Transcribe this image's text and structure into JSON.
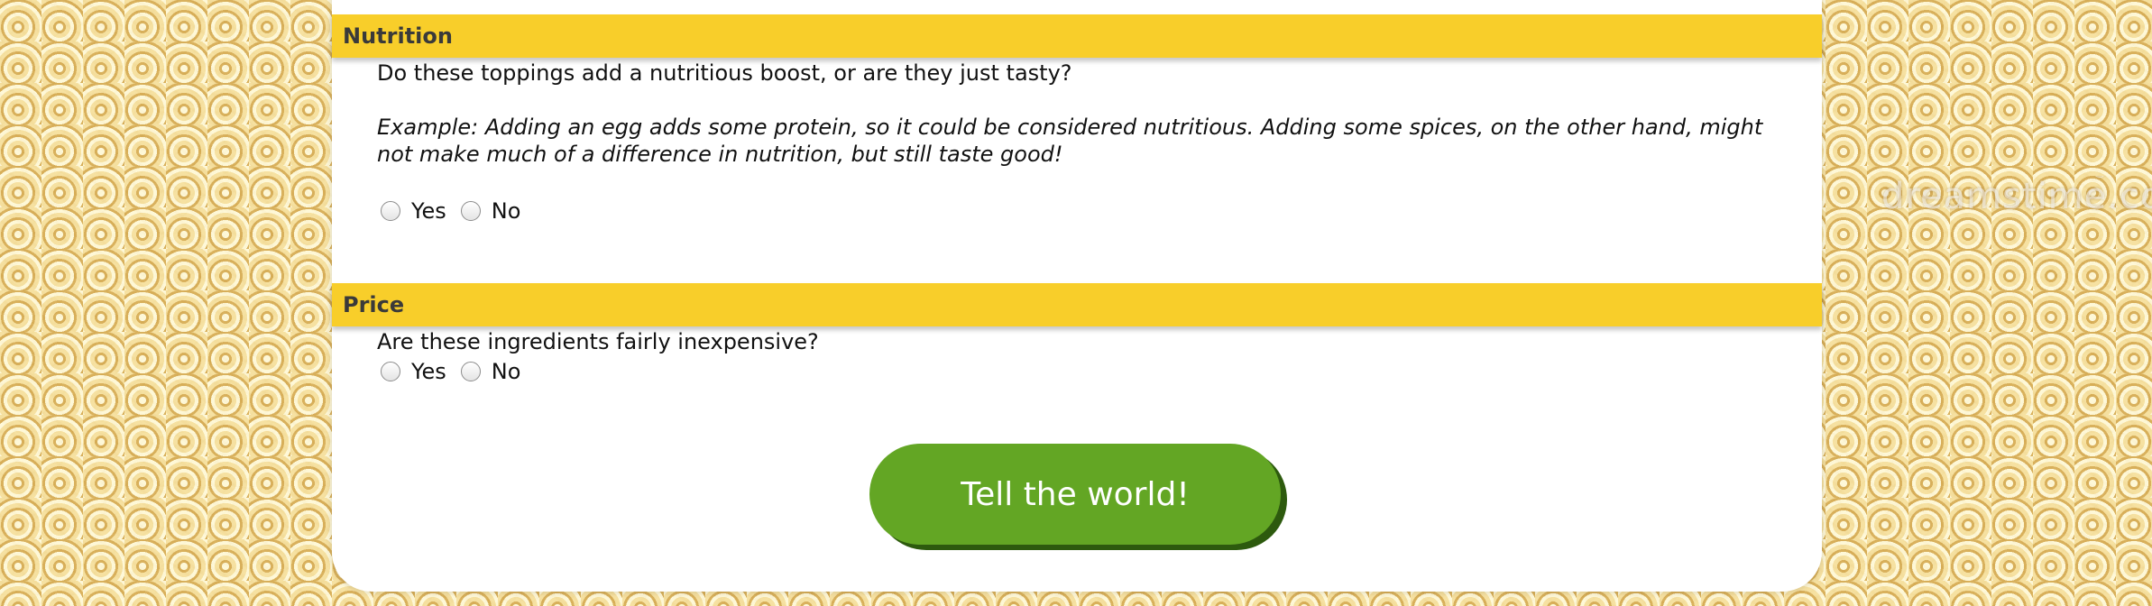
{
  "watermark": {
    "text": "dreamstime.com",
    "copyright": "©"
  },
  "nutrition": {
    "header": "Nutrition",
    "question": "Do these toppings add a nutritious boost, or are they just tasty?",
    "example": "Example: Adding an egg adds some protein, so it could be considered nutritious. Adding some spices, on the other hand, might not make much of a difference in nutrition, but still taste good!",
    "options": [
      "Yes",
      "No"
    ]
  },
  "price": {
    "header": "Price",
    "question": "Are these ingredients fairly inexpensive?",
    "options": [
      "Yes",
      "No"
    ]
  },
  "submit": {
    "label": "Tell the world!"
  }
}
